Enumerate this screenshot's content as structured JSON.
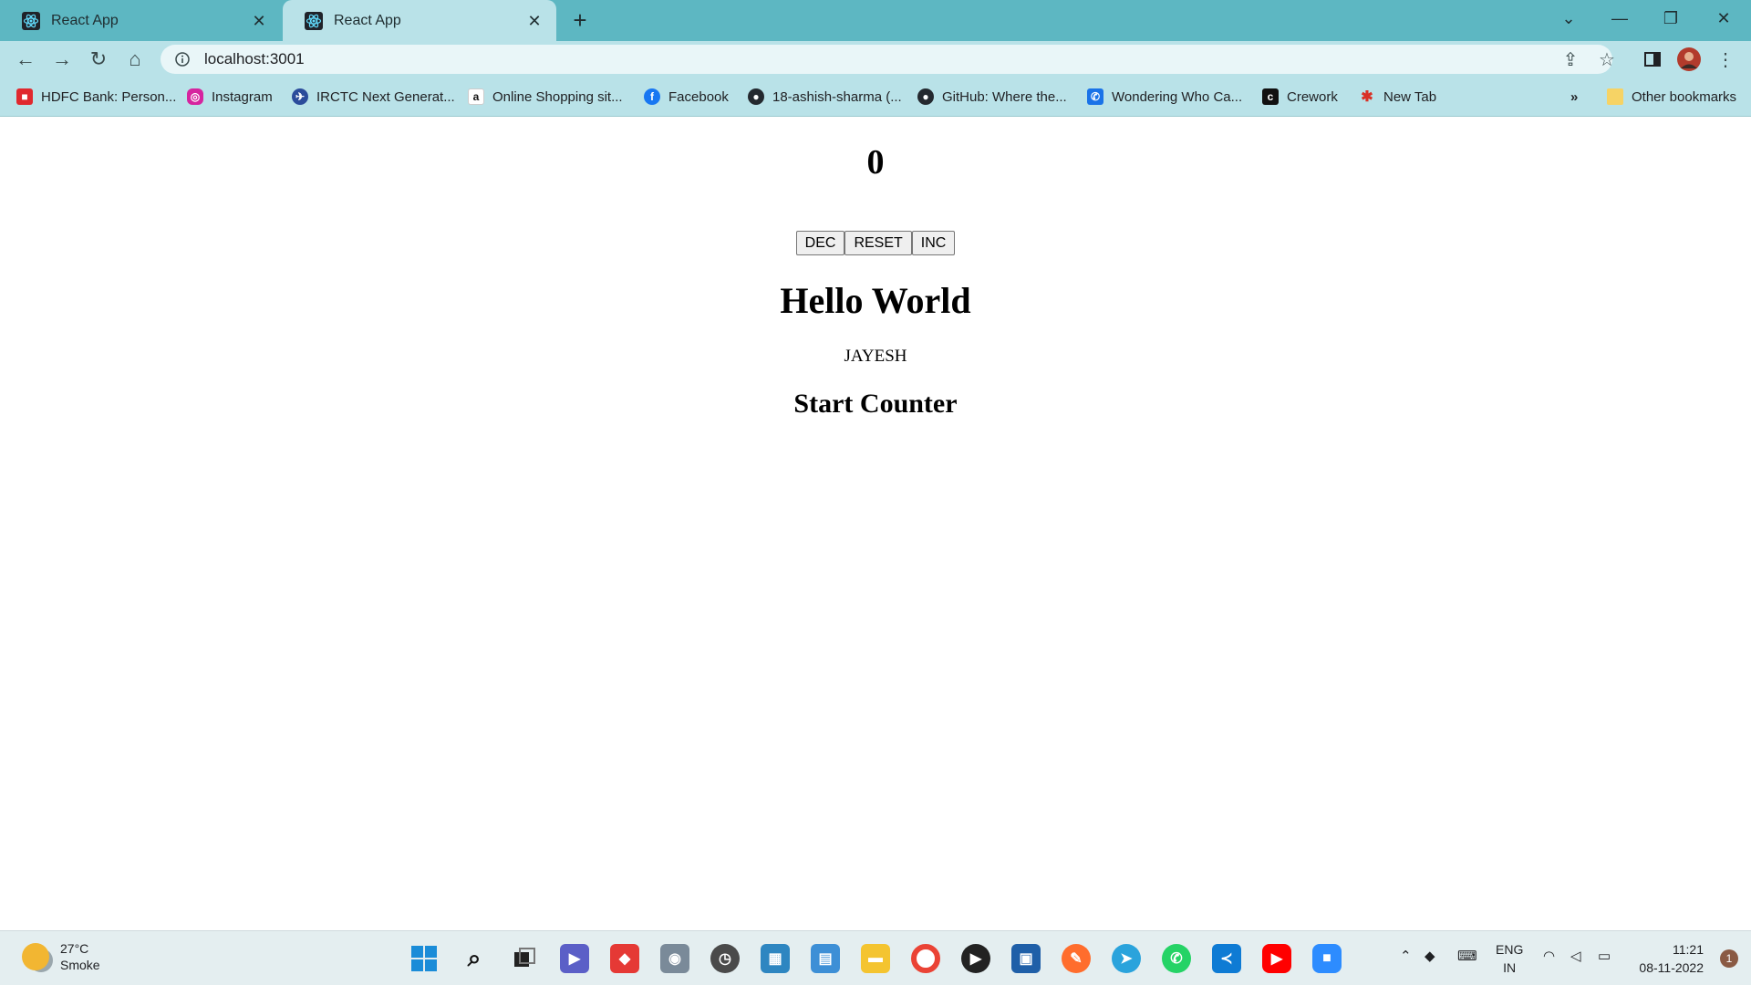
{
  "browser": {
    "tabs": [
      {
        "title": "React App",
        "active": false
      },
      {
        "title": "React App",
        "active": true
      }
    ],
    "address": "localhost:3001",
    "bookmarks": [
      {
        "label": "HDFC Bank: Person...",
        "icon": "hdfc-icon",
        "color": "#e0282e"
      },
      {
        "label": "Instagram",
        "icon": "instagram-icon",
        "color": "#d6249f"
      },
      {
        "label": "IRCTC Next Generat...",
        "icon": "irctc-icon",
        "color": "#2b4c9b"
      },
      {
        "label": "Online Shopping sit...",
        "icon": "amazon-icon",
        "color": "#ffffff"
      },
      {
        "label": "Facebook",
        "icon": "facebook-icon",
        "color": "#1877f2"
      },
      {
        "label": "18-ashish-sharma (...",
        "icon": "github-icon",
        "color": "#24292f"
      },
      {
        "label": "GitHub: Where the...",
        "icon": "github-icon",
        "color": "#24292f"
      },
      {
        "label": "Wondering Who Ca...",
        "icon": "phone-icon",
        "color": "#1a73e8"
      },
      {
        "label": "Crework",
        "icon": "crework-icon",
        "color": "#111111"
      },
      {
        "label": "New Tab",
        "icon": "newtab-icon",
        "color": "#d93025"
      }
    ],
    "overflow": "»",
    "other_bookmarks": "Other bookmarks"
  },
  "app": {
    "count": "0",
    "buttons": {
      "dec": "DEC",
      "reset": "RESET",
      "inc": "INC"
    },
    "heading": "Hello World",
    "name": "JAYESH",
    "subheading": "Start Counter"
  },
  "taskbar": {
    "weather_temp": "27°C",
    "weather_desc": "Smoke",
    "lang_top": "ENG",
    "lang_bottom": "IN",
    "time": "11:21",
    "date": "08-11-2022",
    "notifications": "1"
  }
}
